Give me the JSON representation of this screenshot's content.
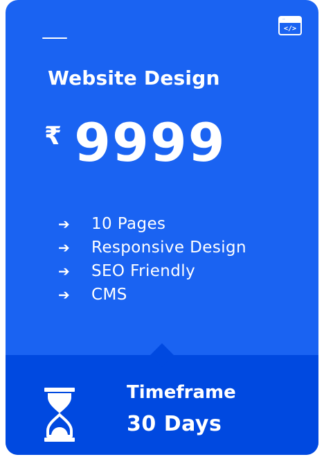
{
  "card": {
    "title": "Website Design",
    "currency": "₹",
    "price": "9999",
    "icon": "code-window-icon",
    "features": [
      {
        "arrow": "➔",
        "label": "10 Pages"
      },
      {
        "arrow": "➔",
        "label": "Responsive Design"
      },
      {
        "arrow": "➔",
        "label": "SEO Friendly"
      },
      {
        "arrow": "➔",
        "label": "CMS"
      }
    ],
    "timeframe_label": "Timeframe",
    "timeframe_value": "30 Days",
    "timeframe_icon": "hourglass-icon"
  },
  "colors": {
    "card_bg": "#1a63f2",
    "bottom_bg": "#0049e0",
    "text": "#ffffff"
  }
}
